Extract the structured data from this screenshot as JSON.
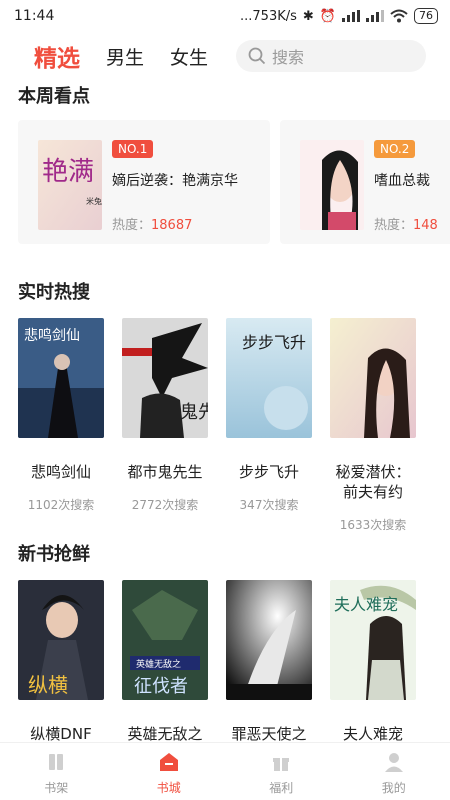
{
  "status": {
    "time": "11:44",
    "network": "...753K/s",
    "battery": "76"
  },
  "tabs": [
    {
      "label": "精选",
      "active": true
    },
    {
      "label": "男生",
      "active": false
    },
    {
      "label": "女生",
      "active": false
    }
  ],
  "search": {
    "placeholder": "搜索"
  },
  "weekly": {
    "title": "本周看点",
    "items": [
      {
        "rank": "NO.1",
        "title": "嫡后逆袭：艳满京华",
        "heat_label": "热度：",
        "heat": "18687",
        "badge_color": "#f04e3e"
      },
      {
        "rank": "NO.2",
        "title": "嗜血总裁",
        "heat_label": "热度：",
        "heat": "148",
        "badge_color": "#f59a3c"
      }
    ]
  },
  "hot": {
    "title": "实时热搜",
    "items": [
      {
        "title": "悲鸣剑仙",
        "sub": "1102次搜索"
      },
      {
        "title": "都市鬼先生",
        "sub": "2772次搜索"
      },
      {
        "title": "步步飞升",
        "sub": "347次搜索"
      },
      {
        "title": "秘爱潜伏：前夫有约",
        "sub": "1633次搜索"
      }
    ]
  },
  "new": {
    "title": "新书抢鲜",
    "items": [
      {
        "title": "纵横DNF"
      },
      {
        "title": "英雄无敌之征伐者"
      },
      {
        "title": "罪恶天使之罪恶之源"
      },
      {
        "title": "夫人难宠"
      }
    ]
  },
  "cover_texts": {
    "w1": "艳满",
    "w1_author": "米兔",
    "h1": "悲鸣剑仙",
    "h2": "鬼先",
    "h3": "步步飞升",
    "n1": "纵横",
    "n2": "征伐者",
    "n2_top": "英雄无敌之",
    "n4": "夫人难宠"
  },
  "nav": [
    {
      "label": "书架",
      "icon": "bookshelf-icon",
      "active": false
    },
    {
      "label": "书城",
      "icon": "bookstore-icon",
      "active": true
    },
    {
      "label": "福利",
      "icon": "gift-icon",
      "active": false
    },
    {
      "label": "我的",
      "icon": "profile-icon",
      "active": false
    }
  ],
  "colors": {
    "accent": "#f04e3e",
    "badge2": "#f59a3c"
  }
}
